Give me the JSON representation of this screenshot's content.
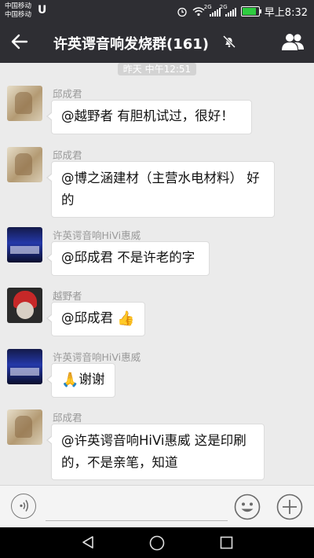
{
  "status_bar": {
    "carrier_1": "中国移动",
    "carrier_2": "中国移动",
    "app_icon": "U",
    "network_1": "2G",
    "network_2": "2G",
    "time": "早上8:32"
  },
  "header": {
    "title": "许英谔音响发烧群(161)",
    "back_icon": "back-arrow-icon",
    "mute_icon": "bell-off-icon",
    "members_icon": "group-members-icon"
  },
  "timestamp": "昨天 中午12:51",
  "messages": [
    {
      "sender": "邱成君",
      "text": "@越野者 有胆机试过，很好！",
      "avatar": "beige"
    },
    {
      "sender": "邱成君",
      "line1": "@博之涵建材（主营水电材料） 好",
      "line2": "的",
      "avatar": "beige"
    },
    {
      "sender": "许英谔音响HiVi惠威",
      "text": "@邱成君 不是许老的字",
      "avatar": "stage"
    },
    {
      "sender": "越野者",
      "text": "@邱成君 ",
      "emoji": "👍",
      "avatar": "face"
    },
    {
      "sender": "许英谔音响HiVi惠威",
      "emoji": "🙏",
      "text": "谢谢",
      "avatar": "stage"
    },
    {
      "sender": "邱成君",
      "line1": "@许英谔音响HiVi惠威 这是印刷",
      "line2": "的，不是亲笔，知道",
      "avatar": "beige"
    }
  ],
  "input_bar": {
    "voice_icon": "voice-icon",
    "emoji_icon": "emoji-face-icon",
    "plus_icon": "plus-icon",
    "input_value": ""
  },
  "nav_bar": {
    "back_icon": "nav-back-icon",
    "home_icon": "nav-home-icon",
    "recent_icon": "nav-recent-icon"
  },
  "colors": {
    "bar": "#2e2e33",
    "background": "#ebebeb",
    "bubble": "#ffffff",
    "sender_name": "#999999"
  }
}
